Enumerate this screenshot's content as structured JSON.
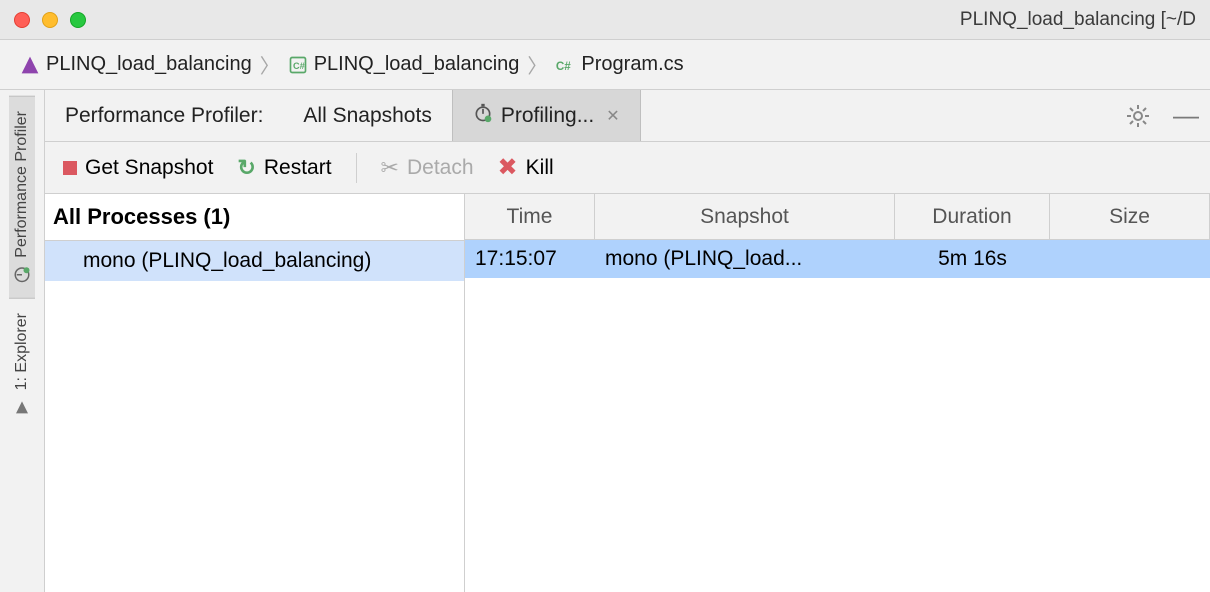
{
  "window": {
    "title": "PLINQ_load_balancing [~/D"
  },
  "breadcrumb": {
    "items": [
      {
        "label": "PLINQ_load_balancing",
        "icon": "project"
      },
      {
        "label": "PLINQ_load_balancing",
        "icon": "csproj"
      },
      {
        "label": "Program.cs",
        "icon": "csfile"
      }
    ]
  },
  "rail": {
    "profiler": "Performance Profiler",
    "explorer": "1: Explorer"
  },
  "panel": {
    "title": "Performance Profiler:",
    "tab_all": "All Snapshots",
    "tab_profiling": "Profiling..."
  },
  "toolbar": {
    "snapshot": "Get Snapshot",
    "restart": "Restart",
    "detach": "Detach",
    "kill": "Kill"
  },
  "tree": {
    "header": "All Processes (1)",
    "row0": "mono (PLINQ_load_balancing)"
  },
  "grid": {
    "columns": {
      "time": "Time",
      "snapshot": "Snapshot",
      "duration": "Duration",
      "size": "Size"
    },
    "rows": [
      {
        "time": "17:15:07",
        "snapshot": "mono (PLINQ_load...",
        "duration": "5m 16s",
        "size": ""
      }
    ]
  }
}
